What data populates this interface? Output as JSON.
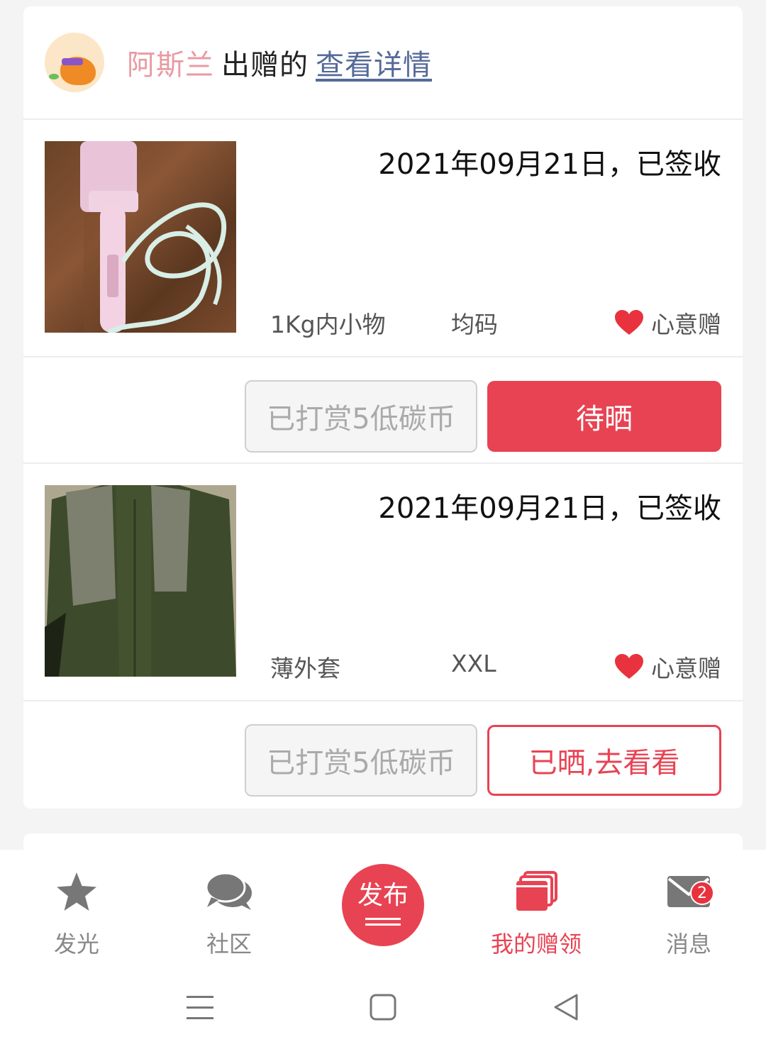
{
  "header": {
    "donor_name": "阿斯兰",
    "action_text": "出赠的",
    "detail_link": "查看详情"
  },
  "items": [
    {
      "date_status": "2021年09月21日，已签收",
      "category": "1Kg内小物",
      "size": "均码",
      "gift_type": "心意赠",
      "reward_label": "已打赏5低碳币",
      "action_label": "待晒"
    },
    {
      "date_status": "2021年09月21日，已签收",
      "category": "薄外套",
      "size": "XXL",
      "gift_type": "心意赠",
      "reward_label": "已打赏5低碳币",
      "action_label": "已晒,去看看"
    }
  ],
  "tabbar": {
    "tabs": [
      {
        "label": "发光",
        "icon": "star-icon"
      },
      {
        "label": "社区",
        "icon": "chat-bubbles-icon"
      },
      {
        "label": "发布",
        "icon": "publish-icon"
      },
      {
        "label": "我的赠领",
        "icon": "cards-icon",
        "active": true
      },
      {
        "label": "消息",
        "icon": "mail-icon",
        "badge": "2"
      }
    ]
  },
  "colors": {
    "accent": "#e84353",
    "donor_name": "#e99aa3",
    "link": "#556a98",
    "muted": "#888888"
  }
}
